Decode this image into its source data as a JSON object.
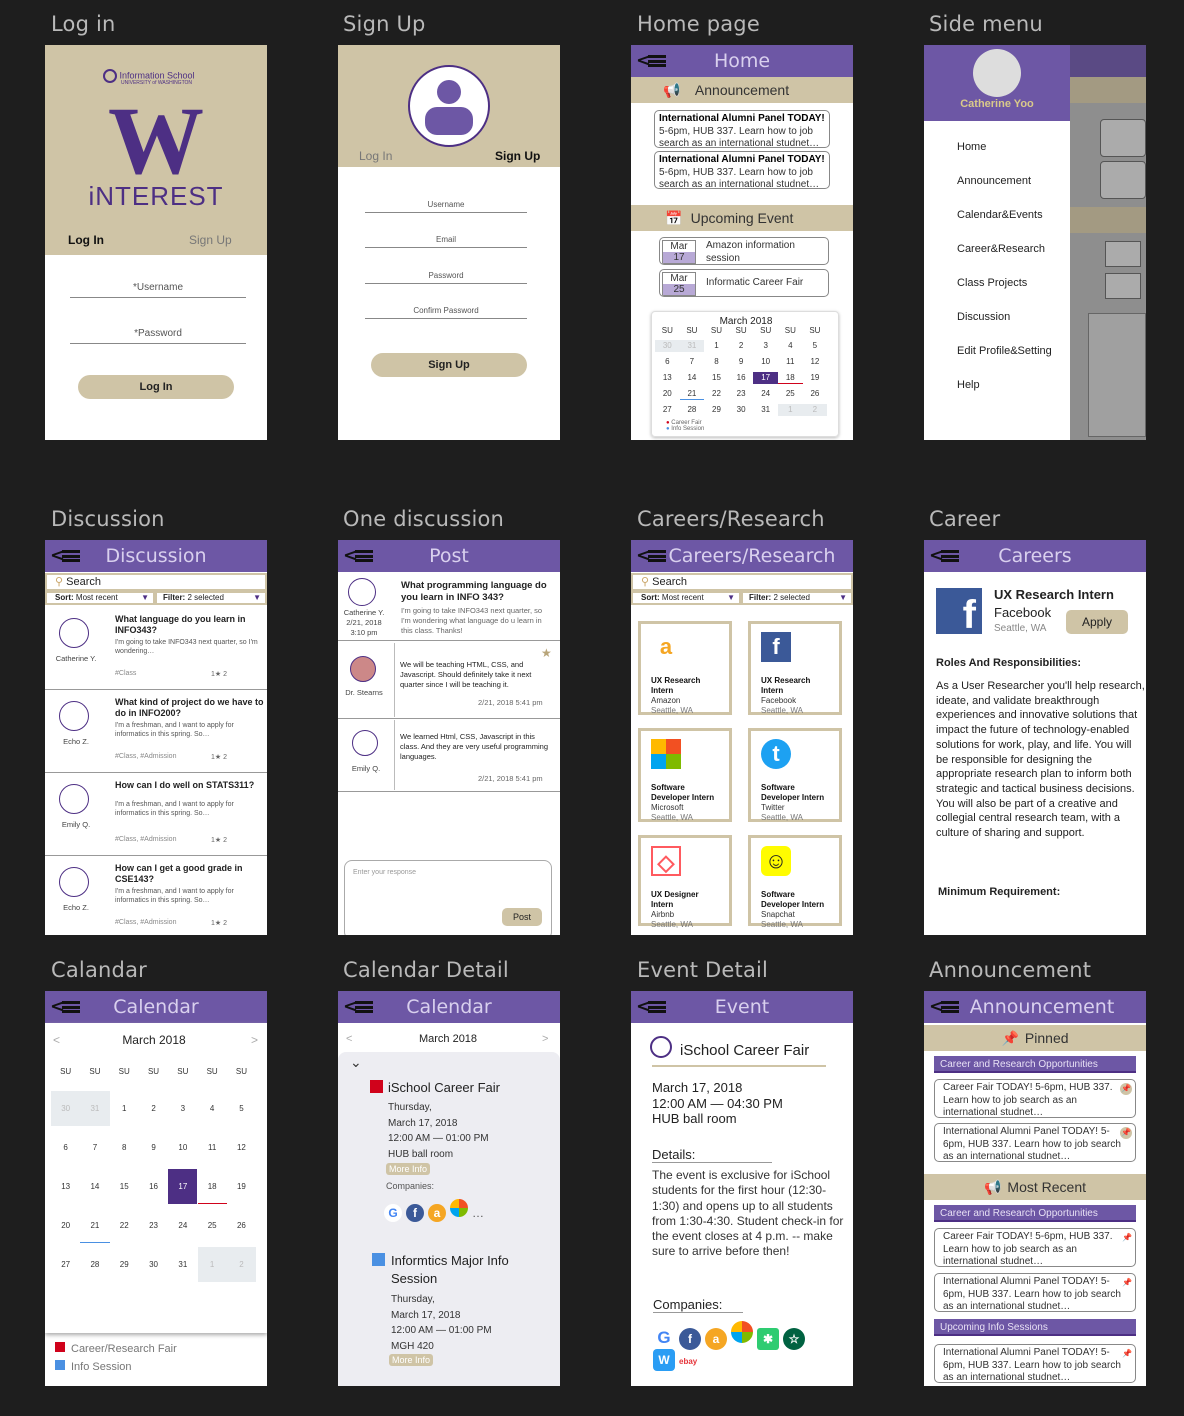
{
  "labels": {
    "login": "Log in",
    "signup": "Sign Up",
    "home": "Home page",
    "sidemenu": "Side menu",
    "discussion": "Discussion",
    "one": "One discussion",
    "careers": "Careers/Research",
    "career": "Career",
    "calendar": "Calandar",
    "caldetail": "Calendar Detail",
    "event": "Event Detail",
    "announce": "Announcement"
  },
  "login": {
    "school": "Information School",
    "uni": "UNIVERSITY of WASHINGTON",
    "w": "W",
    "app": "iNTEREST",
    "tab_login": "Log In",
    "tab_signup": "Sign Up",
    "username": "*Username",
    "password": "*Password",
    "button": "Log In"
  },
  "signup": {
    "tab_login": "Log In",
    "tab_signup": "Sign Up",
    "username": "Username",
    "email": "Email",
    "password": "Password",
    "confirm": "Confirm Password",
    "button": "Sign Up"
  },
  "home": {
    "title": "Home",
    "announcement": "Announcement",
    "ann_title": "International Alumni Panel TODAY!",
    "ann_body": "5-6pm, HUB 337. Learn how to job search as an international studnet…",
    "upcoming": "Upcoming Event",
    "ev1_month": "Mar",
    "ev1_day": "17",
    "ev1": "Amazon information session",
    "ev2_month": "Mar",
    "ev2_day": "25",
    "ev2": "Informatic Career Fair",
    "cal_month": "March 2018",
    "legend1": "Career Fair",
    "legend2": "Info Session"
  },
  "side": {
    "name": "Catherine Yoo",
    "items": [
      "Home",
      "Announcement",
      "Calendar&Events",
      "Career&Research",
      "Class Projects",
      "Discussion",
      "Edit Profile&Setting",
      "Help"
    ]
  },
  "discussion": {
    "title": "Discussion",
    "search": "Search",
    "sort": "Sort:",
    "sort_val": "Most recent",
    "filter": "Filter:",
    "filter_val": "2 selected",
    "posts": [
      {
        "q": "What language do you learn in INFO343?",
        "body": "I'm going to take INFO343 next quarter, so I'm wondering…",
        "user": "Catherine Y.",
        "tags": "#Class",
        "stats": "1★ 2"
      },
      {
        "q": "What kind of project do we have to do in INFO200?",
        "body": "I'm a freshman, and I want to apply for informatics in this spring. So…",
        "user": "Echo Z.",
        "tags": "#Class, #Admission",
        "stats": "1★ 2"
      },
      {
        "q": "How can I do well on STATS311?",
        "body": "I'm a freshman, and I want to apply for informatics in this spring. So…",
        "user": "Emily Q.",
        "tags": "#Class, #Admission",
        "stats": "1★ 2"
      },
      {
        "q": "How can I get a good grade in CSE143?",
        "body": "I'm a freshman, and I want to apply for informatics in this spring. So…",
        "user": "Echo Z.",
        "tags": "#Class, #Admission",
        "stats": "1★ 2"
      }
    ]
  },
  "post": {
    "title": "Post",
    "q": "What programming language do you learn in INFO 343?",
    "body": "I'm going to take INFO343 next quarter, so I'm wondering what language do u learn in this class. Thanks!",
    "user": "Catherine Y.",
    "date": "2/21, 2018",
    "time": "3:10 pm",
    "r1_user": "Dr. Stearns",
    "r1": "We will be teaching HTML, CSS, and Javascript. Should definitely take it next quarter since I will be teaching it.",
    "r1_date": "2/21, 2018 5:41 pm",
    "r2_user": "Emily Q.",
    "r2": "We learned Html, CSS, Javascript in this class. And they are very useful programming languages.",
    "r2_date": "2/21, 2018 5:41 pm",
    "placeholder": "Enter your response",
    "button": "Post"
  },
  "careers": {
    "title": "Careers/Research",
    "search": "Search",
    "sort": "Sort:",
    "sort_val": "Most recent",
    "filter": "Filter:",
    "filter_val": "2 selected",
    "items": [
      {
        "role": "UX Research Intern",
        "co": "Amazon",
        "loc": "Seattle, WA",
        "logo": "a"
      },
      {
        "role": "UX Research Intern",
        "co": "Facebook",
        "loc": "Seattle, WA",
        "logo": "f"
      },
      {
        "role": "Software Developer Intern",
        "co": "Microsoft",
        "loc": "Seattle, WA",
        "logo": ""
      },
      {
        "role": "Software Developer Intern",
        "co": "Twitter",
        "loc": "Seattle, WA",
        "logo": "t"
      },
      {
        "role": "UX Designer Intern",
        "co": "Airbnb",
        "loc": "Seattle, WA",
        "logo": "◇"
      },
      {
        "role": "Software Developer Intern",
        "co": "Snapchat",
        "loc": "Seattle, WA",
        "logo": "☺"
      }
    ]
  },
  "career": {
    "title": "Careers",
    "role": "UX Research Intern",
    "co": "Facebook",
    "loc": "Seattle, WA",
    "apply": "Apply",
    "roles_h": "Roles And Responsibilities:",
    "desc": "As a User Researcher you'll help research, ideate, and validate breakthrough experiences and innovative solutions that impact the future of technology-enabled solutions for work, play, and life. You will be responsible for designing the appropriate research plan to inform both strategic and tactical business decisions. You will also be part of a creative and collegial central research team, with a culture of sharing and support.",
    "min_h": "Minimum Requirement:"
  },
  "calendar": {
    "title": "Calendar",
    "month": "March 2018",
    "legend1": "Career/Research Fair",
    "legend2": "Info Session"
  },
  "caldetail": {
    "title": "Calendar",
    "month": "March 2018",
    "e1": "iSchool Career Fair",
    "e1_day": "Thursday,",
    "e1_date": "March 17, 2018",
    "e1_time": "12:00 AM — 01:00 PM",
    "e1_loc": "HUB ball room",
    "more": "More Info",
    "companies": "Companies:",
    "e2": "Informtics Major Info Session",
    "e2_day": "Thursday,",
    "e2_date": "March 17, 2018",
    "e2_time": "12:00 AM — 01:00 PM",
    "e2_loc": "MGH 420",
    "more2": "More Info"
  },
  "event": {
    "title": "Event",
    "name": "iSchool Career Fair",
    "date": "March 17, 2018",
    "time": "12:00 AM — 04:30 PM",
    "loc": "HUB ball room",
    "details_h": "Details:",
    "details": "The event is exclusive for iSchool students for the first hour (12:30-1:30) and opens up to all students from 1:30-4:30. Student check-in for the event closes at 4 p.m. -- make sure to arrive before then!",
    "companies": "Companies:"
  },
  "announce": {
    "title": "Announcement",
    "pinned": "Pinned",
    "cat1": "Career and Research Opportunities",
    "a1": "Career Fair TODAY! 5-6pm, HUB 337. Learn how to job search as an international studnet…",
    "a2": "International Alumni Panel TODAY! 5-6pm, HUB 337. Learn how to job search as an international studnet…",
    "recent": "Most Recent",
    "cat2": "Career and Research Opportunities",
    "a3": "Career Fair TODAY! 5-6pm, HUB 337. Learn how to job search as an international studnet…",
    "a4": "International Alumni Panel TODAY! 5-6pm, HUB 337. Learn how to job search as an international studnet…",
    "cat3": "Upcoming Info Sessions",
    "a5": "International Alumni Panel TODAY! 5-6pm, HUB 337. Learn how to job search as an international studnet…"
  },
  "colors": {
    "purple": "#6d57a5",
    "tan": "#cfc4a6",
    "dark_purple": "#4d2f84",
    "red": "#d0021b",
    "blue": "#4a90e2"
  }
}
